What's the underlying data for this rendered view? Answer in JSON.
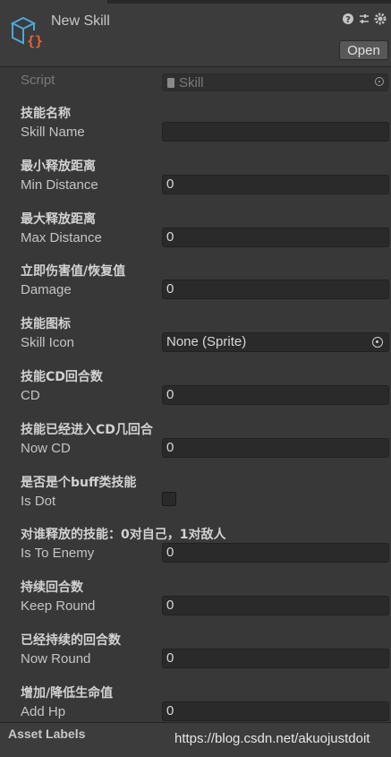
{
  "header": {
    "title": "New Skill",
    "open_label": "Open"
  },
  "script_field": {
    "label": "Script",
    "value": "Skill"
  },
  "fields": [
    {
      "cn": "技能名称",
      "en": "Skill Name",
      "type": "text",
      "value": ""
    },
    {
      "cn": "最小释放距离",
      "en": "Min Distance",
      "type": "number",
      "value": "0"
    },
    {
      "cn": "最大释放距离",
      "en": "Max Distance",
      "type": "number",
      "value": "0"
    },
    {
      "cn": "立即伤害值/恢复值",
      "en": "Damage",
      "type": "number",
      "value": "0"
    },
    {
      "cn": "技能图标",
      "en": "Skill Icon",
      "type": "object",
      "value": "None (Sprite)"
    },
    {
      "cn": "技能CD回合数",
      "en": "CD",
      "type": "number",
      "value": "0"
    },
    {
      "cn": "技能已经进入CD几回合",
      "en": "Now CD",
      "type": "number",
      "value": "0"
    },
    {
      "cn": "是否是个buff类技能",
      "en": "Is Dot",
      "type": "checkbox",
      "checked": false
    },
    {
      "cn": "对谁释放的技能：0对自己，1对敌人",
      "en": "Is To Enemy",
      "type": "number",
      "value": "0"
    },
    {
      "cn": "持续回合数",
      "en": "Keep Round",
      "type": "number",
      "value": "0"
    },
    {
      "cn": "已经持续的回合数",
      "en": "Now Round",
      "type": "number",
      "value": "0"
    },
    {
      "cn": "增加/降低生命值",
      "en": "Add Hp",
      "type": "number",
      "value": "0"
    }
  ],
  "footer": {
    "asset_labels": "Asset Labels",
    "watermark": "https://blog.csdn.net/akuojustdoit"
  }
}
